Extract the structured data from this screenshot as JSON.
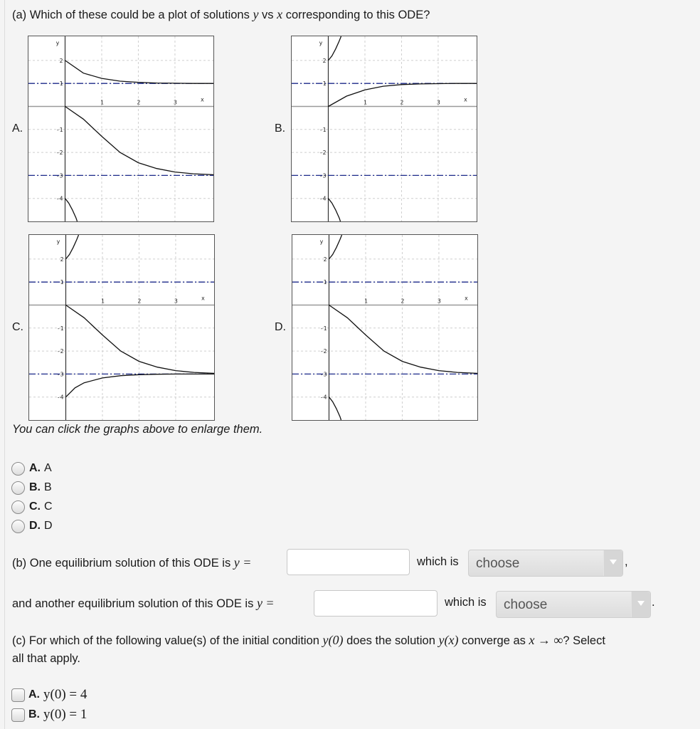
{
  "part_a": {
    "question_prefix": "(a) Which of these could be a plot of solutions ",
    "var_y": "y",
    "vs": " vs ",
    "var_x": "x",
    "question_suffix": " corresponding to this ODE?",
    "hint": "You can click the graphs above to enlarge them.",
    "options": [
      {
        "letter": "A.",
        "text": "A"
      },
      {
        "letter": "B.",
        "text": "B"
      },
      {
        "letter": "C.",
        "text": "C"
      },
      {
        "letter": "D.",
        "text": "D"
      }
    ]
  },
  "chart_data": [
    {
      "type": "line",
      "label": "A.",
      "xlabel": "x",
      "ylabel": "y",
      "xlim": [
        -1,
        4.05
      ],
      "ylim": [
        -5,
        3.05
      ],
      "x_ticks": [
        "1",
        "2",
        "3"
      ],
      "y_ticks": [
        "2",
        "1",
        "-1",
        "-2",
        "-3",
        "-4"
      ],
      "y_tick_values": [
        2,
        1,
        -1,
        -2,
        -3,
        -4
      ],
      "x_tick_values": [
        1,
        2,
        3
      ],
      "grid": true,
      "equilibria": [
        1,
        -3
      ],
      "colors": {
        "curve": "#111111",
        "equilibrium": "#1c2a8a",
        "grid": "#cfcfcf",
        "axis": "#333333"
      },
      "series": [
        {
          "name": "y(0)=2",
          "x": [
            0,
            0.5,
            1,
            1.5,
            2,
            2.5,
            3,
            3.5,
            4.05
          ],
          "y": [
            2,
            1.45,
            1.22,
            1.1,
            1.05,
            1.02,
            1.01,
            1.0,
            1.0
          ]
        },
        {
          "name": "y(0)=0",
          "x": [
            0,
            0.5,
            1,
            1.5,
            2,
            2.5,
            3,
            3.5,
            4.05
          ],
          "y": [
            0,
            -0.55,
            -1.3,
            -2.0,
            -2.45,
            -2.7,
            -2.85,
            -2.93,
            -2.97
          ]
        },
        {
          "name": "y(0)=-4",
          "x": [
            0,
            0.1,
            0.2,
            0.3,
            0.33
          ],
          "y": [
            -4,
            -4.2,
            -4.5,
            -4.85,
            -5
          ]
        }
      ]
    },
    {
      "type": "line",
      "label": "B.",
      "xlabel": "x",
      "ylabel": "y",
      "xlim": [
        -1,
        4.05
      ],
      "ylim": [
        -5,
        3.05
      ],
      "x_ticks": [
        "1",
        "2",
        "3"
      ],
      "y_ticks": [
        "2",
        "1",
        "-1",
        "-2",
        "-3",
        "-4"
      ],
      "y_tick_values": [
        2,
        1,
        -1,
        -2,
        -3,
        -4
      ],
      "x_tick_values": [
        1,
        2,
        3
      ],
      "grid": true,
      "equilibria": [
        1,
        -3
      ],
      "colors": {
        "curve": "#111111",
        "equilibrium": "#1c2a8a",
        "grid": "#cfcfcf",
        "axis": "#333333"
      },
      "series": [
        {
          "name": "y(0)=2",
          "x": [
            0,
            0.1,
            0.2,
            0.3,
            0.35
          ],
          "y": [
            2,
            2.2,
            2.5,
            2.85,
            3.05
          ]
        },
        {
          "name": "y(0)=0",
          "x": [
            0,
            0.5,
            1,
            1.5,
            2,
            2.5,
            3,
            3.5,
            4.05
          ],
          "y": [
            0,
            0.45,
            0.72,
            0.88,
            0.95,
            0.98,
            0.99,
            1.0,
            1.0
          ]
        },
        {
          "name": "y(0)=-4",
          "x": [
            0,
            0.1,
            0.2,
            0.3,
            0.33
          ],
          "y": [
            -4,
            -4.2,
            -4.5,
            -4.85,
            -5
          ]
        }
      ]
    },
    {
      "type": "line",
      "label": "C.",
      "xlabel": "x",
      "ylabel": "y",
      "xlim": [
        -1,
        4.05
      ],
      "ylim": [
        -5,
        3.05
      ],
      "x_ticks": [
        "1",
        "2",
        "3"
      ],
      "y_ticks": [
        "2",
        "1",
        "-1",
        "-2",
        "-3",
        "-4"
      ],
      "y_tick_values": [
        2,
        1,
        -1,
        -2,
        -3,
        -4
      ],
      "x_tick_values": [
        1,
        2,
        3
      ],
      "grid": true,
      "equilibria": [
        1,
        -3
      ],
      "colors": {
        "curve": "#111111",
        "equilibrium": "#1c2a8a",
        "grid": "#cfcfcf",
        "axis": "#333333"
      },
      "series": [
        {
          "name": "y(0)=2",
          "x": [
            0,
            0.1,
            0.2,
            0.3,
            0.35
          ],
          "y": [
            2,
            2.2,
            2.5,
            2.85,
            3.05
          ]
        },
        {
          "name": "y(0)=0",
          "x": [
            0,
            0.5,
            1,
            1.5,
            2,
            2.5,
            3,
            3.5,
            4.05
          ],
          "y": [
            0,
            -0.55,
            -1.3,
            -2.0,
            -2.45,
            -2.7,
            -2.85,
            -2.93,
            -2.97
          ]
        },
        {
          "name": "y(0)=-4",
          "x": [
            0,
            0.25,
            0.5,
            1,
            1.5,
            2,
            2.5,
            3,
            4.05
          ],
          "y": [
            -4,
            -3.6,
            -3.38,
            -3.17,
            -3.07,
            -3.03,
            -3.01,
            -3.0,
            -3.0
          ]
        }
      ]
    },
    {
      "type": "line",
      "label": "D.",
      "xlabel": "x",
      "ylabel": "y",
      "xlim": [
        -1,
        4.05
      ],
      "ylim": [
        -5,
        3.05
      ],
      "x_ticks": [
        "1",
        "2",
        "3"
      ],
      "y_ticks": [
        "2",
        "1",
        "-1",
        "-2",
        "-3",
        "-4"
      ],
      "y_tick_values": [
        2,
        1,
        -1,
        -2,
        -3,
        -4
      ],
      "x_tick_values": [
        1,
        2,
        3
      ],
      "grid": true,
      "equilibria": [
        1,
        -3
      ],
      "colors": {
        "curve": "#111111",
        "equilibrium": "#1c2a8a",
        "grid": "#cfcfcf",
        "axis": "#333333"
      },
      "series": [
        {
          "name": "y(0)=2",
          "x": [
            0,
            0.1,
            0.2,
            0.3,
            0.35
          ],
          "y": [
            2,
            2.2,
            2.5,
            2.85,
            3.05
          ]
        },
        {
          "name": "y(0)=0",
          "x": [
            0,
            0.5,
            1,
            1.5,
            2,
            2.5,
            3,
            3.5,
            4.05
          ],
          "y": [
            0,
            -0.55,
            -1.3,
            -2.0,
            -2.45,
            -2.7,
            -2.85,
            -2.93,
            -2.97
          ]
        },
        {
          "name": "y(0)=-4",
          "x": [
            0,
            0.1,
            0.2,
            0.3,
            0.33
          ],
          "y": [
            -4,
            -4.2,
            -4.5,
            -4.85,
            -5
          ]
        }
      ]
    }
  ],
  "part_b": {
    "line1_prefix": "(b) One equilibrium solution of this ODE is ",
    "line2_prefix": "and another equilibrium solution of this ODE is ",
    "y_eq": "y =",
    "input1_value": "",
    "input2_value": "",
    "which_is": "which is",
    "select1_value": "choose",
    "select2_value": "choose",
    "line1_end": ",",
    "line2_end": "."
  },
  "part_c": {
    "q_prefix": "(c) For which of the following value(s) of the initial condition ",
    "ic": "y(0)",
    "q_mid1": " does the solution ",
    "yx": "y(x)",
    "q_mid2": " converge as ",
    "limit": "x → ∞",
    "q_suffix": "? Select",
    "q_line2": "all that apply.",
    "options": [
      {
        "letter": "A.",
        "math": "y(0) = 4"
      },
      {
        "letter": "B.",
        "math": "y(0) = 1"
      }
    ]
  }
}
